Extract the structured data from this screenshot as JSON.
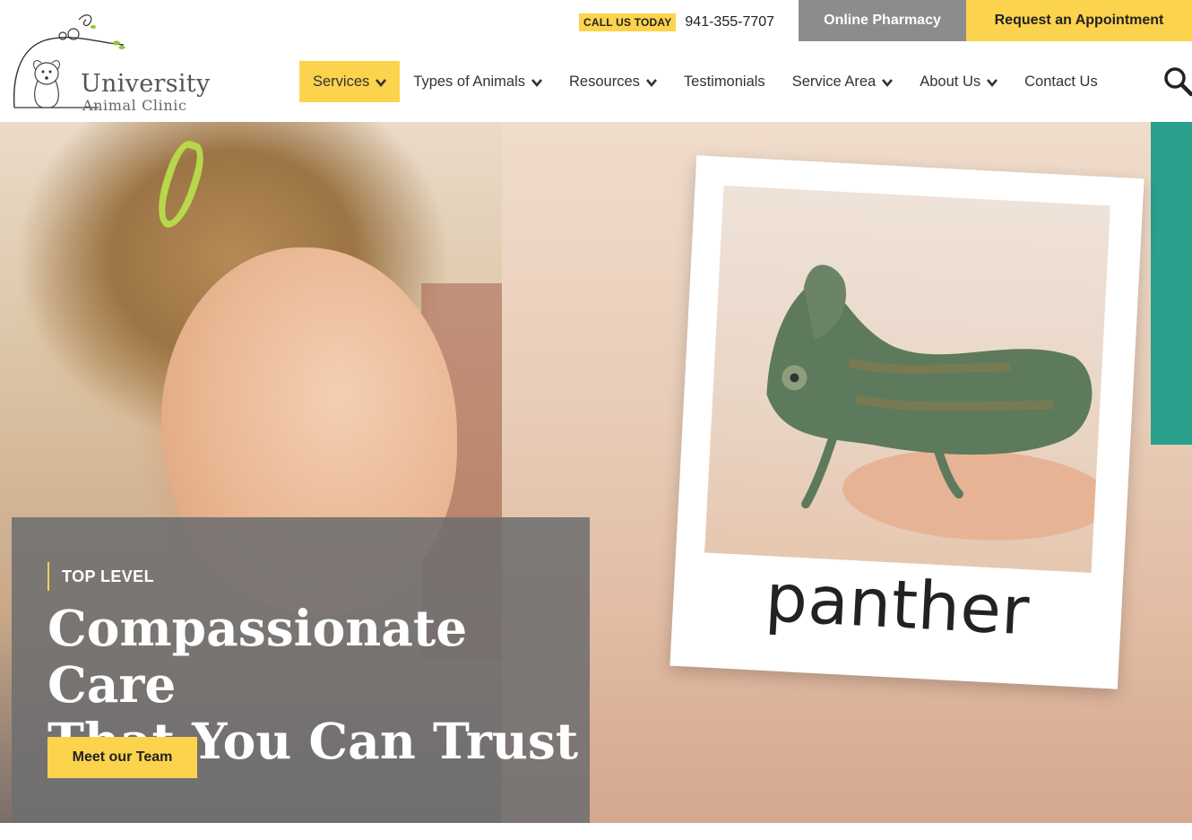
{
  "logo": {
    "name_line1": "University",
    "name_line2": "Animal Clinic"
  },
  "topbar": {
    "call_badge": "CALL US TODAY",
    "phone": "941-355-7707",
    "pharmacy_button": "Online Pharmacy",
    "appointment_button": "Request an Appointment"
  },
  "nav": {
    "items": [
      {
        "label": "Services",
        "dropdown": true,
        "active": true
      },
      {
        "label": "Types of Animals",
        "dropdown": true
      },
      {
        "label": "Resources",
        "dropdown": true
      },
      {
        "label": "Testimonials",
        "dropdown": false
      },
      {
        "label": "Service Area",
        "dropdown": true
      },
      {
        "label": "About Us",
        "dropdown": true
      },
      {
        "label": "Contact Us",
        "dropdown": false
      }
    ],
    "search_icon": "search-icon"
  },
  "hero": {
    "photo_caption": "panther",
    "eyebrow": "TOP LEVEL",
    "headline_line1": "Compassionate Care",
    "headline_line2": "That You Can Trust",
    "cta_label": "Meet our Team"
  },
  "colors": {
    "accent_yellow": "#fcd34d",
    "pharmacy_gray": "#8c8c8c",
    "overlay_gray": "#6e6e70"
  }
}
